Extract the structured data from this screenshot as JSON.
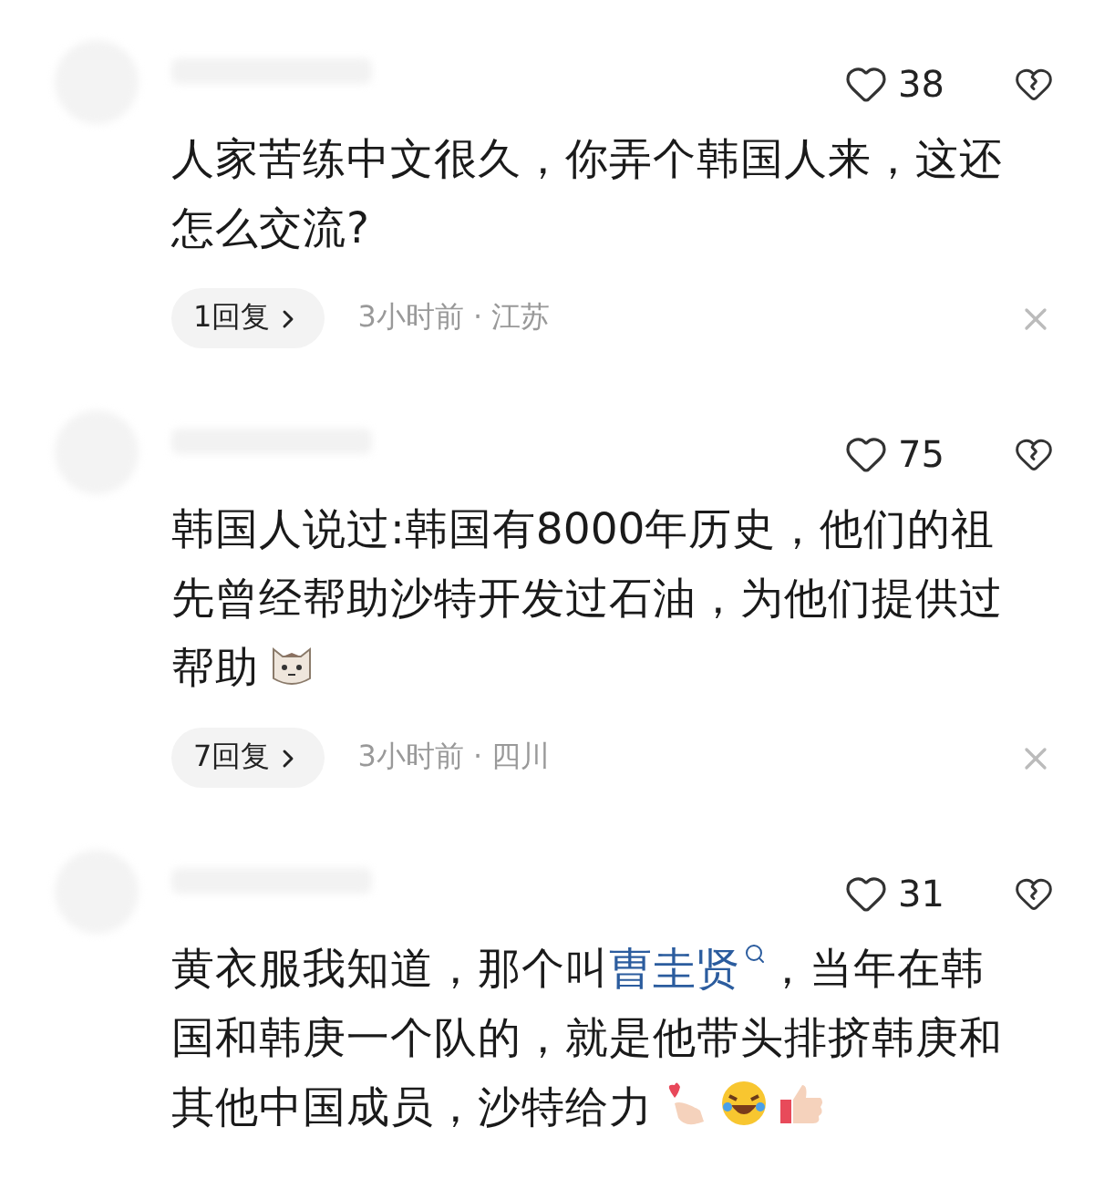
{
  "comments": [
    {
      "likes": "38",
      "body": [
        {
          "kind": "text",
          "text": "人家苦练中文很久，你弄个韩国人来，这还怎么交流?"
        }
      ],
      "replies": "1回复",
      "meta": "3小时前 · 江苏"
    },
    {
      "likes": "75",
      "body": [
        {
          "kind": "text",
          "text": "韩国人说过:韩国有8000年历史，他们的祖先曾经帮助沙特开发过石油，为他们提供过帮助"
        },
        {
          "kind": "cat"
        }
      ],
      "replies": "7回复",
      "meta": "3小时前 · 四川"
    },
    {
      "likes": "31",
      "body": [
        {
          "kind": "text",
          "text": "黄衣服我知道，那个叫"
        },
        {
          "kind": "link",
          "text": "曺圭贤"
        },
        {
          "kind": "text",
          "text": "，当年在韩国和韩庚一个队的，就是他带头排挤韩庚和其他中国成员，沙特给力"
        },
        {
          "kind": "heart"
        },
        {
          "kind": "laugh"
        },
        {
          "kind": "thumb"
        }
      ]
    }
  ]
}
